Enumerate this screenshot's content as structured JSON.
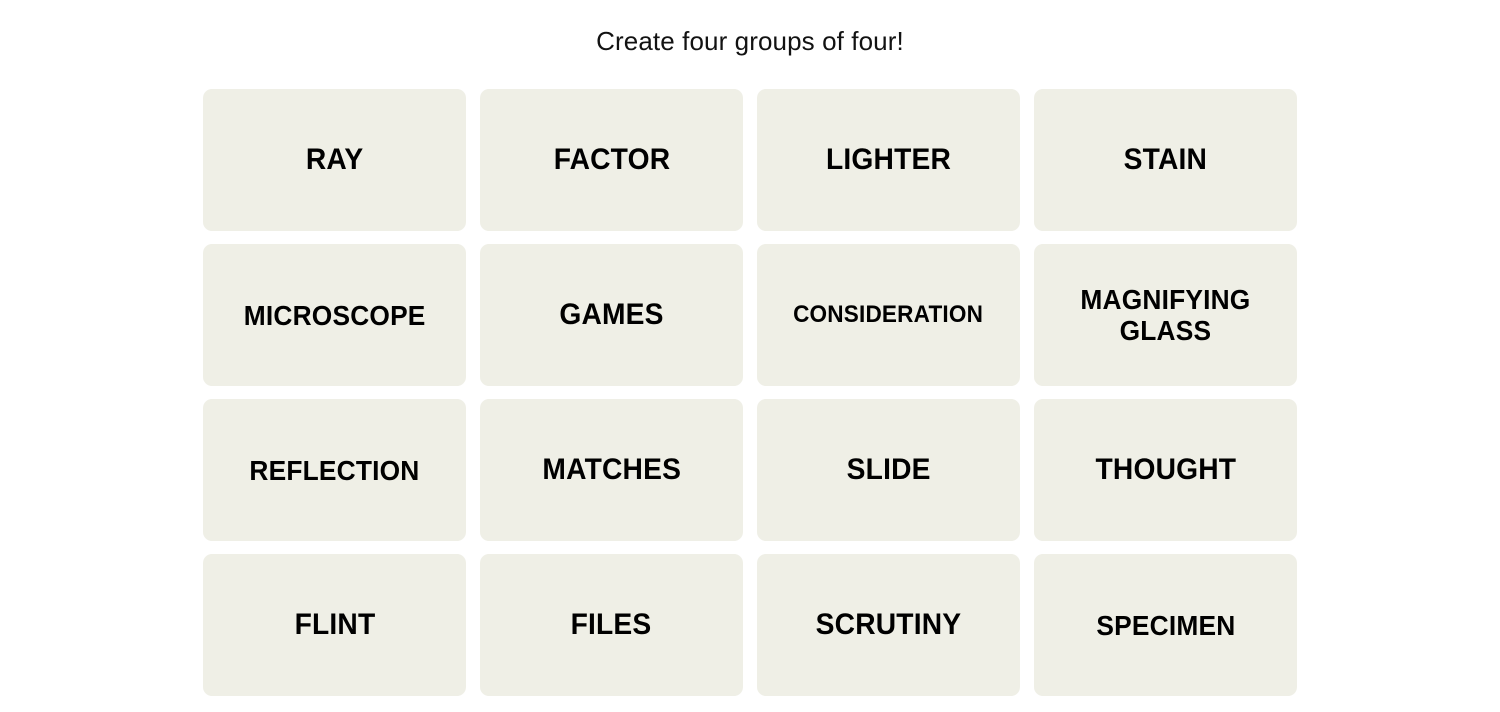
{
  "page": {
    "background_color": "#ffffff"
  },
  "board": {
    "title": "Create four groups of four!",
    "rows": 4,
    "columns": 4,
    "tile_color": "#efefe6",
    "tile_text_color": "#000000",
    "tiles": [
      {
        "label": "RAY",
        "size": "lg"
      },
      {
        "label": "FACTOR",
        "size": "lg"
      },
      {
        "label": "LIGHTER",
        "size": "lg"
      },
      {
        "label": "STAIN",
        "size": "lg"
      },
      {
        "label": "MICROSCOPE",
        "size": "md"
      },
      {
        "label": "GAMES",
        "size": "lg"
      },
      {
        "label": "CONSIDERATION",
        "size": "sm"
      },
      {
        "label": "MAGNIFYING\nGLASS",
        "size": "wrap"
      },
      {
        "label": "REFLECTION",
        "size": "md"
      },
      {
        "label": "MATCHES",
        "size": "lg"
      },
      {
        "label": "SLIDE",
        "size": "lg"
      },
      {
        "label": "THOUGHT",
        "size": "lg"
      },
      {
        "label": "FLINT",
        "size": "lg"
      },
      {
        "label": "FILES",
        "size": "lg"
      },
      {
        "label": "SCRUTINY",
        "size": "lg"
      },
      {
        "label": "SPECIMEN",
        "size": "md"
      }
    ]
  }
}
